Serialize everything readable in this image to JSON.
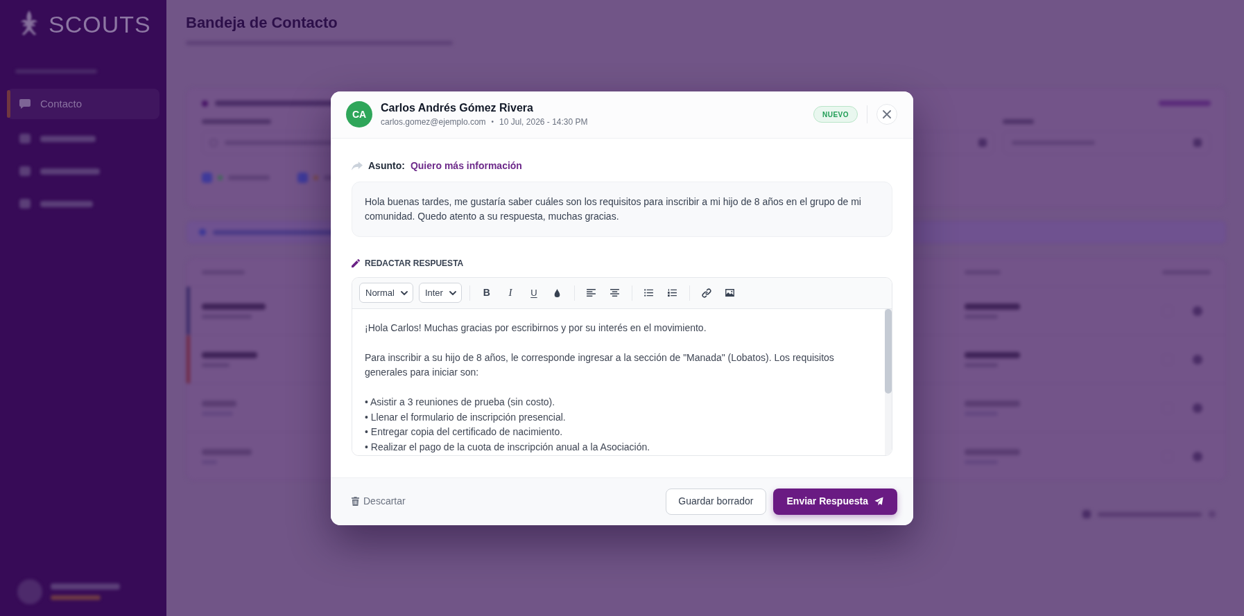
{
  "background": {
    "logo": "SCOUTS",
    "nav_items": [
      {
        "label": "Contacto",
        "selected": true
      }
    ],
    "page_title": "Bandeja de Contacto"
  },
  "modal": {
    "sender": {
      "initials": "CA",
      "name": "Carlos Andrés Gómez Rivera",
      "email": "carlos.gomez@ejemplo.com",
      "separator": "•",
      "date": "10 Jul, 2026 - 14:30 PM"
    },
    "status_badge": "NUEVO",
    "subject": {
      "label": "Asunto:",
      "value": "Quiero más información"
    },
    "message": "Hola buenas tardes, me gustaría saber cuáles son los requisitos para inscribir a mi hijo de 8 años en el grupo de mi comunidad. Quedo atento a su respuesta, muchas gracias.",
    "reply_heading": "REDACTAR RESPUESTA",
    "editor": {
      "toolbar": [
        [
          {
            "kind": "select",
            "value": "Normal"
          },
          {
            "kind": "select",
            "value": "Inter"
          }
        ],
        [
          {
            "kind": "bold",
            "label": "B"
          },
          {
            "kind": "italic",
            "label": "I"
          },
          {
            "kind": "underline",
            "label": "U"
          },
          {
            "kind": "color"
          }
        ],
        [
          {
            "kind": "align-left"
          },
          {
            "kind": "align-center"
          }
        ],
        [
          {
            "kind": "bullet-list"
          },
          {
            "kind": "ordered-list"
          }
        ],
        [
          {
            "kind": "link"
          },
          {
            "kind": "image"
          }
        ]
      ],
      "content": [
        {
          "kind": "paragraph",
          "text": "¡Hola Carlos! Muchas gracias por escribirnos y por su interés en el movimiento."
        },
        {
          "kind": "paragraph",
          "text": "Para inscribir a su hijo de 8 años, le corresponde ingresar a la sección de \"Manada\" (Lobatos). Los requisitos generales para iniciar son:"
        },
        {
          "kind": "list",
          "items": [
            "• Asistir a 3 reuniones de prueba (sin costo).",
            "• Llenar el formulario de inscripción presencial.",
            "• Entregar copia del certificado de nacimiento.",
            "• Realizar el pago de la cuota de inscripción anual a la Asociación."
          ]
        }
      ]
    },
    "actions": {
      "discard": "Descartar",
      "save": "Guardar borrador",
      "send": "Enviar Respuesta"
    }
  }
}
